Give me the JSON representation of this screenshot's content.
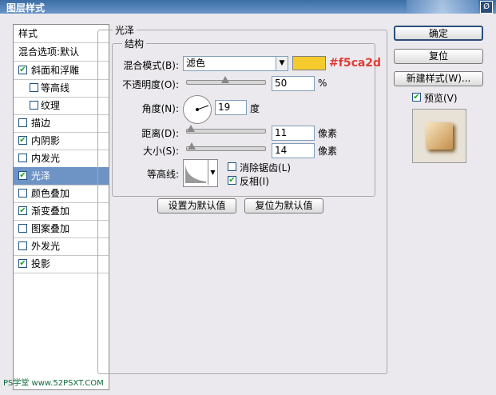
{
  "window": {
    "title": "图层样式",
    "close": "Ø"
  },
  "styles_header": "样式",
  "blend_default": "混合选项:默认",
  "styles": [
    {
      "label": "斜面和浮雕",
      "checked": true
    },
    {
      "label": "等高线",
      "checked": false,
      "sub": true
    },
    {
      "label": "纹理",
      "checked": false,
      "sub": true
    },
    {
      "label": "描边",
      "checked": false
    },
    {
      "label": "内阴影",
      "checked": true
    },
    {
      "label": "内发光",
      "checked": false
    },
    {
      "label": "光泽",
      "checked": true,
      "selected": true
    },
    {
      "label": "颜色叠加",
      "checked": false
    },
    {
      "label": "渐变叠加",
      "checked": true
    },
    {
      "label": "图案叠加",
      "checked": false
    },
    {
      "label": "外发光",
      "checked": false
    },
    {
      "label": "投影",
      "checked": true
    }
  ],
  "panel": {
    "section": "光泽",
    "structure": "结构",
    "blend_mode_label": "混合模式(B):",
    "blend_mode_value": "滤色",
    "color": "#f5ca2d",
    "color_hex_label": "#f5ca2d",
    "opacity_label": "不透明度(O):",
    "opacity_value": "50",
    "opacity_unit": "%",
    "opacity_fraction": 0.5,
    "angle_label": "角度(N):",
    "angle_value": "19",
    "angle_unit": "度",
    "distance_label": "距离(D):",
    "distance_value": "11",
    "distance_unit": "像素",
    "distance_fraction": 0.05,
    "size_label": "大小(S):",
    "size_value": "14",
    "size_unit": "像素",
    "size_fraction": 0.06,
    "contour_label": "等高线:",
    "antialias_label": "消除锯齿(L)",
    "antialias_checked": false,
    "invert_label": "反相(I)",
    "invert_checked": true,
    "set_default": "设置为默认值",
    "reset_default": "复位为默认值"
  },
  "buttons": {
    "ok": "确定",
    "reset": "复位",
    "new_style": "新建样式(W)...",
    "preview": "预览(V)",
    "preview_checked": true
  },
  "watermark": "PS学堂 www.52PSXT.COM"
}
